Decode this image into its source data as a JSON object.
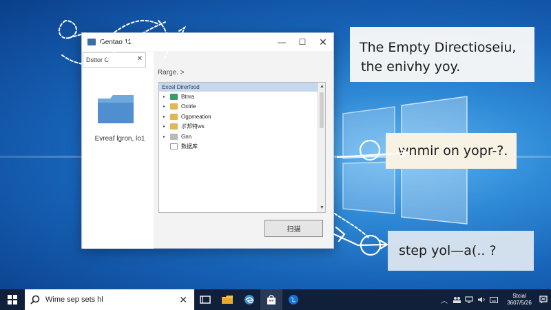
{
  "window": {
    "title": "Gentao 11",
    "minimize_symbol": "—",
    "maximize_symbol": "☐",
    "close_symbol": "✕"
  },
  "left_pane": {
    "tab_label": "Dsttor C",
    "tab_close": "✕",
    "folder_label": "Evreaf lgron, lo1"
  },
  "dialog": {
    "breadcrumb": "Rarge. >",
    "list_header": "Excel Direrfood",
    "tree_items": [
      {
        "label": "Btnra",
        "icon": "folder-green-icon",
        "arrow": "▸"
      },
      {
        "label": "Oxtrle",
        "icon": "folder-icon",
        "arrow": "▸"
      },
      {
        "label": "Ogpmeation",
        "icon": "folder-icon",
        "arrow": "▸"
      },
      {
        "label": "ポ邦特ws",
        "icon": "folder-icon",
        "arrow": "▸"
      },
      {
        "label": "Gnn",
        "icon": "folder-gray-icon",
        "arrow": "▸"
      },
      {
        "label": "数据库",
        "icon": "file-icon",
        "arrow": ""
      }
    ],
    "ok_label": "扫描"
  },
  "callouts": {
    "top_line1": "The Empty Directioseiu,",
    "top_line2": "the enivhy yoy.",
    "middle": "wnmir on yopr-?.",
    "bottom": "step yol—a(..   ?"
  },
  "taskbar": {
    "search_text": "Wime sep sets hl",
    "search_clear": "✕",
    "clock_line1": "Stcial",
    "clock_line2": "3607/5/26"
  },
  "colors": {
    "accent": "#1763b8",
    "taskbar": "#10203a",
    "list_header_bg": "#c5d8ee"
  }
}
